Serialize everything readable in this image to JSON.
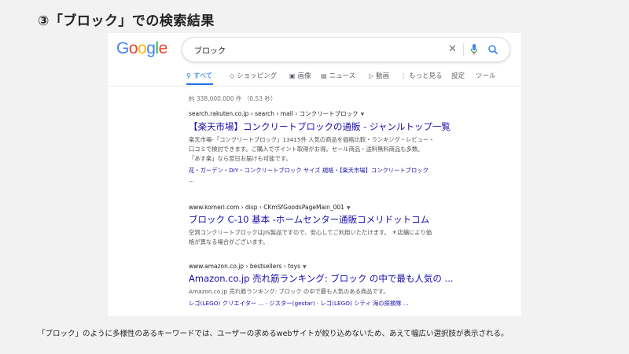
{
  "slide": {
    "title": "③「ブロック」での検索結果",
    "caption": "「ブロック」のように多様性のあるキーワードでは、ユーザーの求めるwebサイトが絞り込めないため、あえて幅広い選択肢が表示される。"
  },
  "logo": {
    "letters": [
      "G",
      "o",
      "o",
      "g",
      "l",
      "e"
    ],
    "colors": [
      "#4285f4",
      "#ea4335",
      "#fbbc05",
      "#4285f4",
      "#34a853",
      "#ea4335"
    ]
  },
  "search": {
    "value": "ブロック",
    "clear_symbol": "✕"
  },
  "tabs": [
    {
      "label": "すべて",
      "icon": "search-icon",
      "active": true
    },
    {
      "label": "ショッピング",
      "icon": "tag-icon",
      "active": false
    },
    {
      "label": "画像",
      "icon": "image-icon",
      "active": false
    },
    {
      "label": "ニュース",
      "icon": "news-icon",
      "active": false
    },
    {
      "label": "動画",
      "icon": "video-icon",
      "active": false
    },
    {
      "label": "もっと見る",
      "icon": "more-icon",
      "active": false
    },
    {
      "label": "設定",
      "icon": "",
      "active": false
    },
    {
      "label": "ツール",
      "icon": "",
      "active": false
    }
  ],
  "stats": "約 338,000,000 件 （0.53 秒）",
  "results": [
    {
      "cite": "search.rakuten.co.jp › search › mall › コンクリートブロック",
      "title": "【楽天市場】コンクリートブロックの通販 - ジャンルトップ一覧",
      "snippet_lines": [
        "楽天市場-「コンクリートブロック」13415件 人気の商品を価格比較・ランキング・レビュー・",
        "口コミで検討できます。ご購入でポイント取得がお得。セール商品・送料無料商品も多数。",
        "「あす楽」なら翌日お届けも可能です。"
      ],
      "sitelinks": [
        "花・ガーデン・DIY・コンクリートブロック サイズ 規格・【楽天市場】コンクリートブロック",
        "..."
      ]
    },
    {
      "cite": "www.komeri.com › disp › CKmSfGoodsPageMain_001",
      "title": "ブロック C-10 基本 -ホームセンター通販コメリドットコム",
      "snippet_lines": [
        "空洞コンクリートブロックはJIS製品ですので、安心してご利用いただけます。 ＊店舗により価",
        "格が異なる場合がございます。"
      ],
      "sitelinks": []
    },
    {
      "cite": "www.amazon.co.jp › bestsellers › toys",
      "title": "Amazon.co.jp 売れ筋ランキング: ブロック の中で最も人気の ...",
      "snippet_lines": [
        "Amazon.co.jp 売れ筋ランキング: ブロック の中で最も人気のある商品です。"
      ],
      "sitelinks": [
        "レゴ(LEGO) クリエイター ... · ジスター(gestar) · レゴ(LEGO) シティ 海の探検隊 ..."
      ]
    }
  ]
}
